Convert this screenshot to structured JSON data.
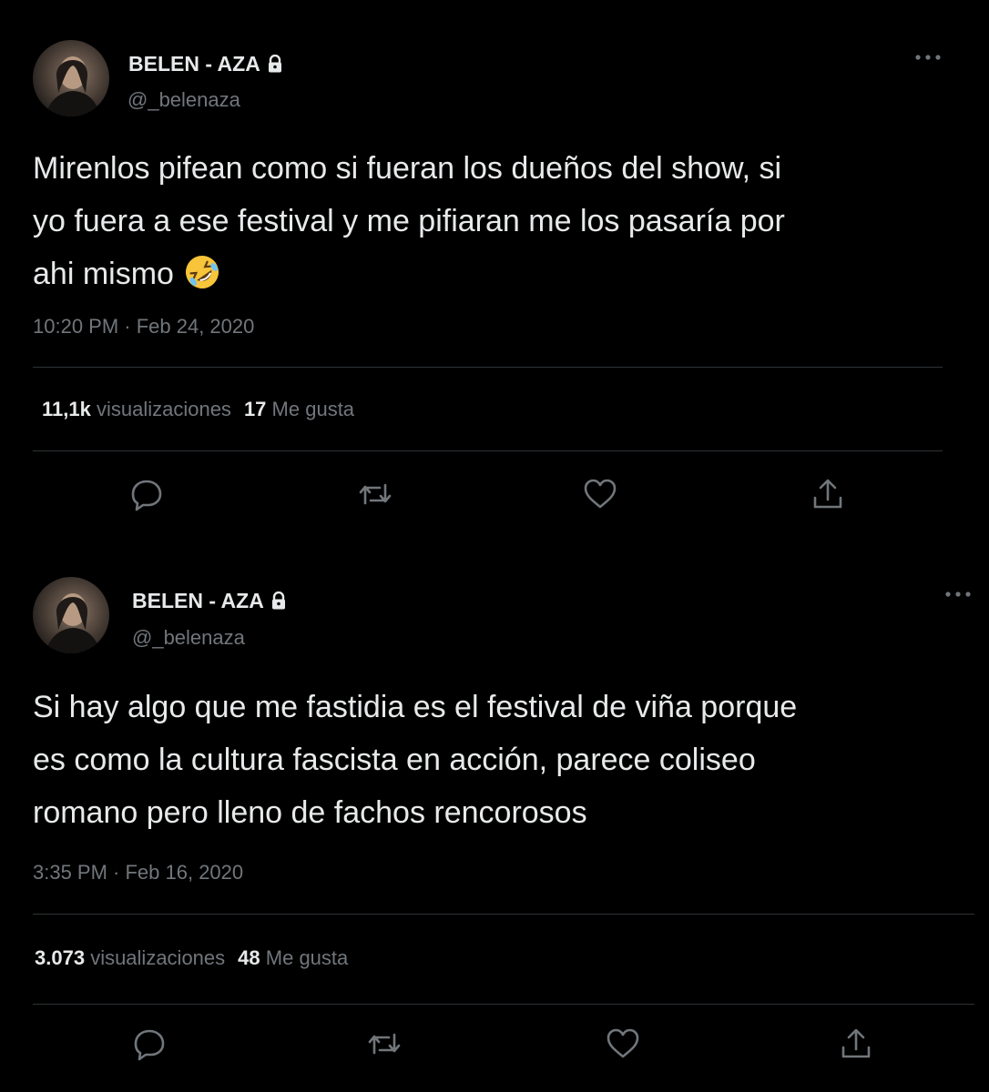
{
  "tweets": [
    {
      "display_name": "BELEN - AZA",
      "handle": "@_belenaza",
      "text_lines": [
        "Mirenlos pifean como si fueran los dueños del show, si",
        "yo fuera a ese festival y me pifiaran me los pasaría por",
        "ahi mismo"
      ],
      "emoji": "rolling-on-floor-laughing-icon",
      "timestamp": "10:20 PM · Feb 24, 2020",
      "views_count": "11,1k",
      "views_label": "visualizaciones",
      "likes_count": "17",
      "likes_label": "Me gusta",
      "actions": [
        "reply-icon",
        "retweet-icon",
        "like-icon",
        "share-icon"
      ]
    },
    {
      "display_name": "BELEN - AZA",
      "handle": "@_belenaza",
      "text_lines": [
        "Si hay algo que me fastidia es el festival de viña porque",
        "es como la cultura fascista en acción, parece coliseo",
        "romano pero lleno de fachos rencorosos"
      ],
      "timestamp": "3:35 PM · Feb 16, 2020",
      "views_count": "3.073",
      "views_label": "visualizaciones",
      "likes_count": "48",
      "likes_label": "Me gusta",
      "actions": [
        "reply-icon",
        "retweet-icon",
        "like-icon",
        "share-icon"
      ]
    }
  ],
  "colors": {
    "background": "#000000",
    "primary_text": "#e7e9ea",
    "secondary_text": "#71767b",
    "divider": "#2f3336"
  }
}
